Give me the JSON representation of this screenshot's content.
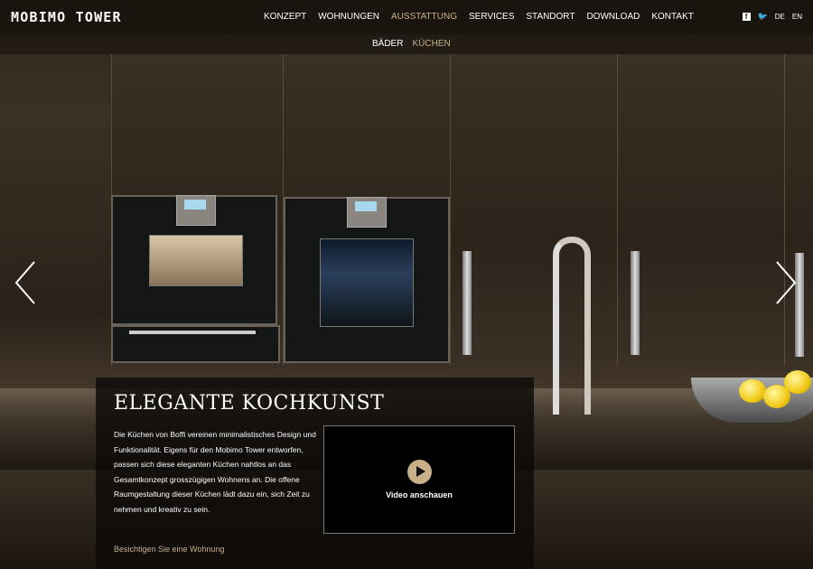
{
  "header": {
    "logo": "MOBIMO TOWER",
    "nav": [
      "KONZEPT",
      "WOHNUNGEN",
      "AUSSTATTUNG",
      "SERVICES",
      "STANDORT",
      "DOWNLOAD",
      "KONTAKT"
    ],
    "active_nav": "AUSSTATTUNG",
    "social": {
      "facebook": "f",
      "twitter": "t"
    },
    "languages": [
      "DE",
      "EN"
    ]
  },
  "subnav": {
    "items": [
      "BÄDER",
      "KÜCHEN"
    ],
    "active": "KÜCHEN"
  },
  "caption": {
    "title": "ELEGANTE KOCHKUNST",
    "text": "Die Küchen von Boffi vereinen minimalistisches Design und Funktionalität. Eigens für den Mobimo Tower entworfen, passen sich diese eleganten Küchen nahtlos an das Gesamtkonzept grosszügigen Wohnens an. Die offene Raumgestaltung dieser Küchen lädt dazu ein, sich Zeit zu nehmen und kreativ zu sein.",
    "link": "Besichtigen Sie eine Wohnung",
    "video_label": "Video anschauen"
  },
  "icons": {
    "prev": "chevron-left-icon",
    "next": "chevron-right-icon",
    "play": "play-icon"
  },
  "colors": {
    "accent": "#c8b189",
    "bar": "#14100c"
  }
}
